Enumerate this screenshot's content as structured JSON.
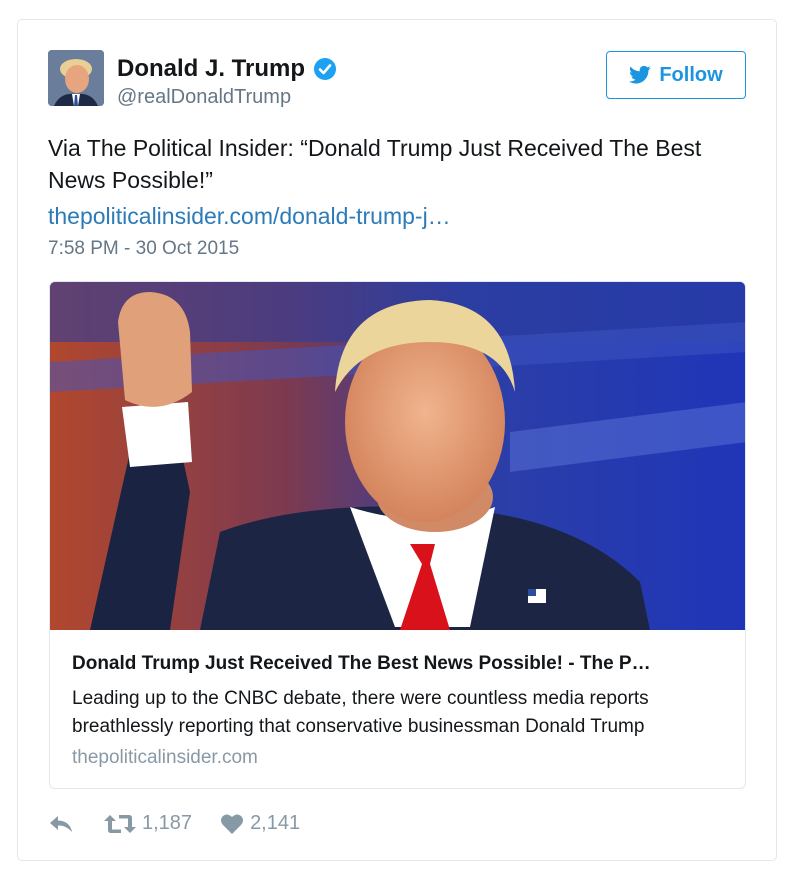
{
  "user": {
    "display_name": "Donald J. Trump",
    "handle": "@realDonaldTrump",
    "verified": true
  },
  "follow_button": {
    "label": "Follow"
  },
  "tweet": {
    "text": "Via The Political Insider: “Donald Trump Just Received The Best News Possible!”",
    "link": "thepoliticalinsider.com/donald-trump-j…",
    "timestamp": "7:58 PM - 30 Oct 2015"
  },
  "card": {
    "title": "Donald Trump Just Received The Best News Possible! - The P…",
    "description": "Leading up to the CNBC debate, there were countless media reports breathlessly reporting that conservative businessman Donald Trump",
    "domain": "thepoliticalinsider.com"
  },
  "actions": {
    "retweet_count": "1,187",
    "like_count": "2,141"
  },
  "colors": {
    "accent": "#1b95e0",
    "link": "#2b7bb9",
    "muted": "#657786",
    "border": "#e1e8ed",
    "verified": "#1da1f2"
  },
  "icons": [
    "verified-badge-icon",
    "twitter-bird-icon",
    "reply-icon",
    "retweet-icon",
    "heart-icon"
  ]
}
